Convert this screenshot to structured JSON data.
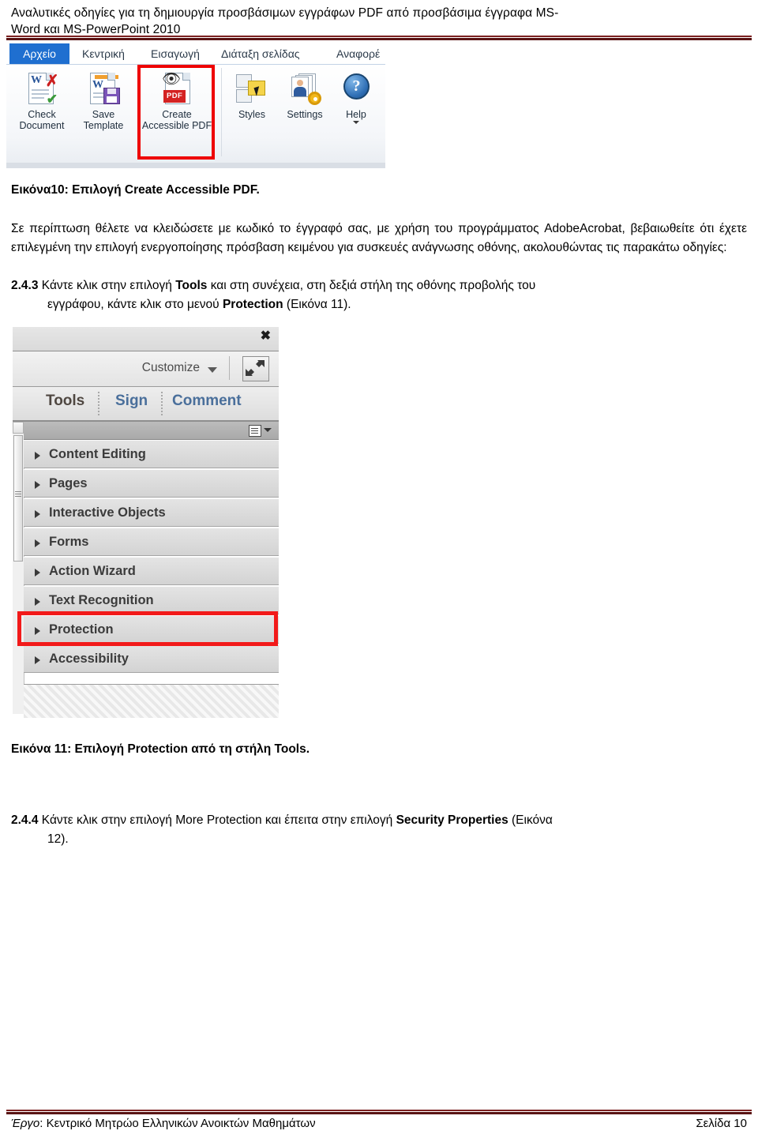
{
  "header": {
    "line1": "Αναλυτικές οδηγίες για τη δημιουργία προσβάσιμων εγγράφων PDF από προσβάσιμα έγγραφα MS-",
    "line2": "Word και MS-PowerPoint 2010"
  },
  "figure10": {
    "tabs": [
      {
        "label": "Αρχείο",
        "active": true
      },
      {
        "label": "Κεντρική",
        "active": false
      },
      {
        "label": "Εισαγωγή",
        "active": false
      },
      {
        "label": "Διάταξη σελίδας",
        "active": false
      },
      {
        "label": "Αναφορέ",
        "active": false
      }
    ],
    "buttons": [
      {
        "line1": "Check",
        "line2": "Document",
        "icon": "check-document-icon"
      },
      {
        "line1": "Save",
        "line2": "Template",
        "icon": "save-template-icon"
      },
      {
        "line1": "Create",
        "line2": "Accessible PDF",
        "icon": "create-accessible-pdf-icon",
        "highlighted": true
      },
      {
        "line1": "Styles",
        "line2": "",
        "icon": "styles-icon"
      },
      {
        "line1": "Settings",
        "line2": "",
        "icon": "settings-icon"
      },
      {
        "line1": "Help",
        "line2": "",
        "icon": "help-icon",
        "has_caret": true
      }
    ],
    "pdf_badge": "PDF",
    "help_glyph": "?",
    "highlight_color": "#ee0000"
  },
  "caption10": "Εικόνα10: Επιλογή Create Accessible PDF.",
  "paragraph1": {
    "text": "Σε περίπτωση θέλετε να κλειδώσετε με κωδικό το έγγραφό σας, με χρήση του προγράμματος AdobeAcrobat, βεβαιωθείτε ότι έχετε επιλεγμένη την επιλογή ενεργοποίησης πρόσβαση κειμένου για συσκευές ανάγνωσης οθόνης, ακολουθώντας τις παρακάτω οδηγίες:"
  },
  "step243": {
    "number": "2.4.3",
    "part1": " Κάντε κλικ στην επιλογή ",
    "bold1": "Tools",
    "part2": " και στη συνέχεια, στη δεξιά στήλη της οθόνης προβολής του",
    "line2_part1": "εγγράφου, κάντε κλικ στο μενού ",
    "line2_bold": "Protection",
    "line2_part2": " (Εικόνα 11)."
  },
  "figure11": {
    "close_glyph": "✖",
    "customize_label": "Customize",
    "tabs": [
      {
        "label": "Tools",
        "active": true
      },
      {
        "label": "Sign",
        "active": false
      },
      {
        "label": "Comment",
        "active": false
      }
    ],
    "rows": [
      {
        "label": "Content Editing",
        "highlighted": false
      },
      {
        "label": "Pages",
        "highlighted": false
      },
      {
        "label": "Interactive Objects",
        "highlighted": false
      },
      {
        "label": "Forms",
        "highlighted": false
      },
      {
        "label": "Action Wizard",
        "highlighted": false
      },
      {
        "label": "Text Recognition",
        "highlighted": false
      },
      {
        "label": "Protection",
        "highlighted": true
      },
      {
        "label": "Accessibility",
        "highlighted": false
      }
    ],
    "highlight_color": "#f21a1a",
    "active_tab_color": "#4f4741",
    "inactive_tab_color": "#4a6f9b"
  },
  "caption11": "Εικόνα 11: Επιλογή Protection από τη στήλη Tools.",
  "step244": {
    "number": "2.4.4",
    "part1": " Κάντε κλικ στην επιλογή More Protection και έπειτα στην επιλογή ",
    "bold1": "Security Properties",
    "part2": " (Εικόνα",
    "line2": "12)."
  },
  "footer": {
    "project_label": "Έργο",
    "project_text": ": Κεντρικό Μητρώο Ελληνικών Ανοικτών Μαθημάτων",
    "page": "Σελίδα 10"
  }
}
